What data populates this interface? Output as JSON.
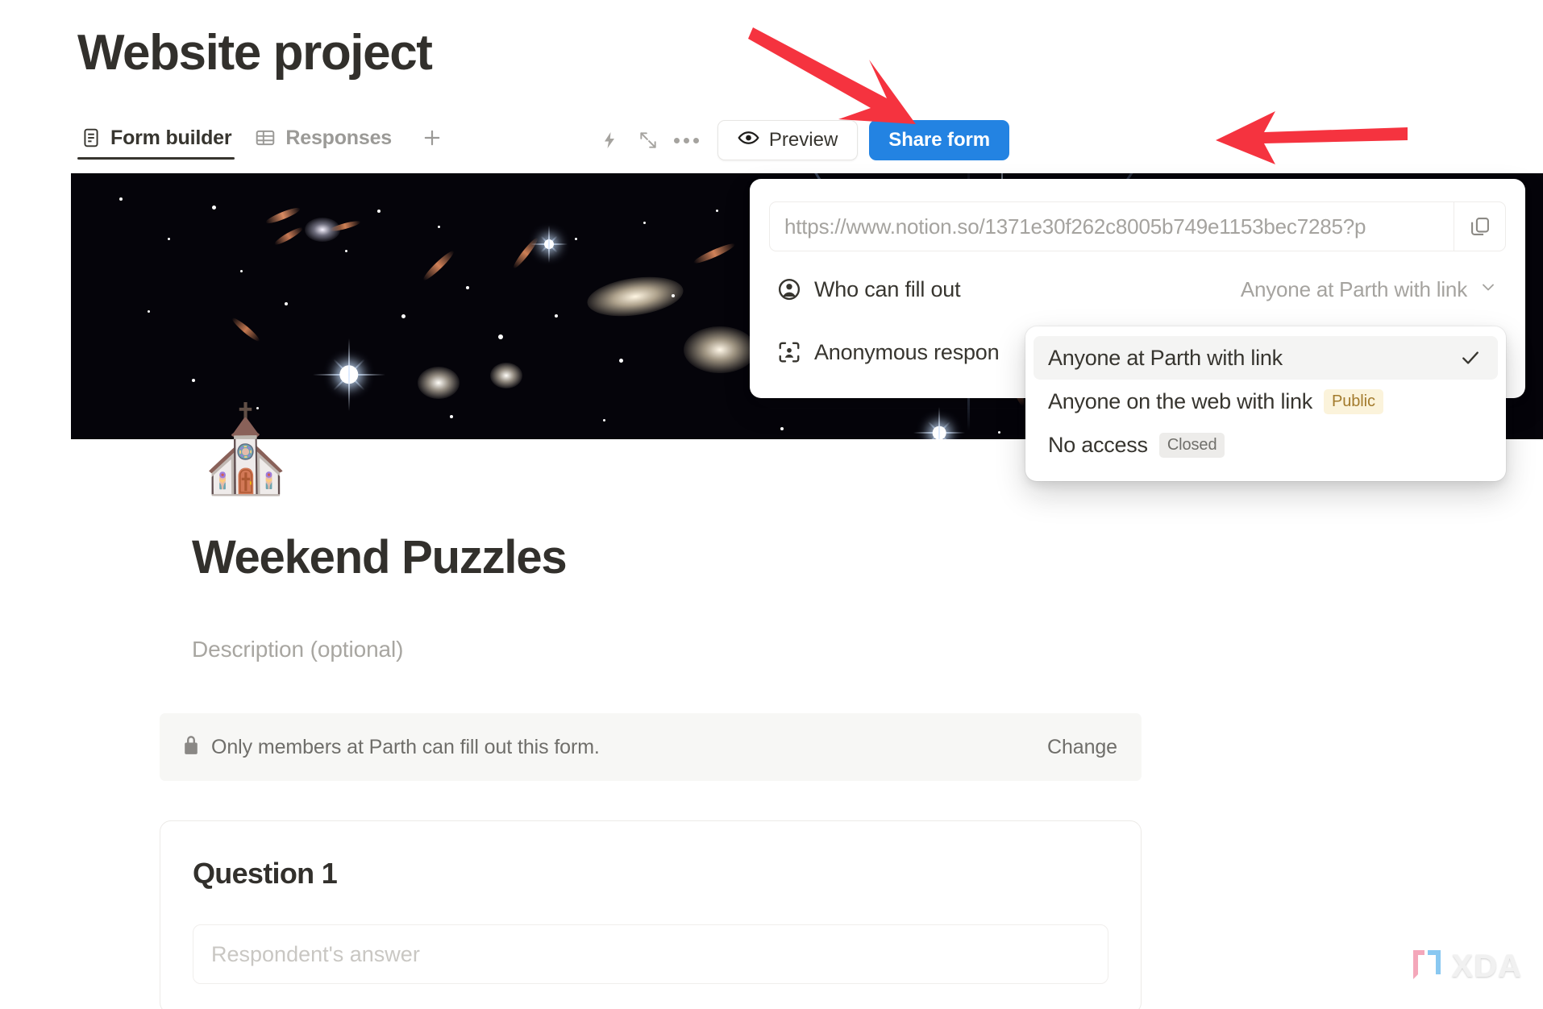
{
  "header": {
    "page_title": "Website project",
    "tabs": [
      {
        "label": "Form builder",
        "icon": "form-document-icon",
        "active": true
      },
      {
        "label": "Responses",
        "icon": "table-grid-icon",
        "active": false
      }
    ],
    "add_tab_icon": "plus-icon"
  },
  "toolbar": {
    "lightning_icon": "lightning-bolt-icon",
    "expand_icon": "expand-collapse-icon",
    "more_icon": "more-options-icon",
    "preview_label": "Preview",
    "preview_icon": "eye-icon",
    "share_label": "Share form"
  },
  "share_popover": {
    "url": "https://www.notion.so/1371e30f262c8005b749e1153bec7285?p",
    "copy_icon": "copy-icon",
    "rows": [
      {
        "icon": "person-circle-icon",
        "label": "Who can fill out",
        "value": "Anyone at Parth with link",
        "chevron": "chevron-down-icon"
      },
      {
        "icon": "anonymous-person-icon",
        "label": "Anonymous respon",
        "value": ""
      }
    ]
  },
  "access_dropdown": {
    "items": [
      {
        "label": "Anyone at Parth with link",
        "badge": "",
        "badge_kind": "",
        "selected": true,
        "check_icon": "check-icon"
      },
      {
        "label": "Anyone on the web with link",
        "badge": "Public",
        "badge_kind": "public",
        "selected": false
      },
      {
        "label": "No access",
        "badge": "Closed",
        "badge_kind": "closed",
        "selected": false
      }
    ]
  },
  "form": {
    "emoji": "⛪",
    "title": "Weekend Puzzles",
    "description_placeholder": "Description (optional)",
    "notice": {
      "icon": "lock-icon",
      "text": "Only members at Parth can fill out this form.",
      "action_label": "Change"
    },
    "question": {
      "title": "Question 1",
      "answer_placeholder": "Respondent's answer"
    }
  },
  "watermark": {
    "text": "XDA",
    "icon": "xda-bracket-logo-icon"
  },
  "annotations": {
    "arrow_color": "#f5333f",
    "arrows": [
      {
        "name": "arrow-pointing-to-more-options",
        "direction": "down-right"
      },
      {
        "name": "arrow-pointing-to-share-form",
        "direction": "left"
      }
    ]
  },
  "colors": {
    "accent_blue": "#2383e2",
    "text_primary": "#37352f",
    "text_muted": "#9b9a97",
    "badge_public_bg": "#fbf3db",
    "badge_public_text": "#a37b2d",
    "badge_closed_bg": "#edecea"
  }
}
